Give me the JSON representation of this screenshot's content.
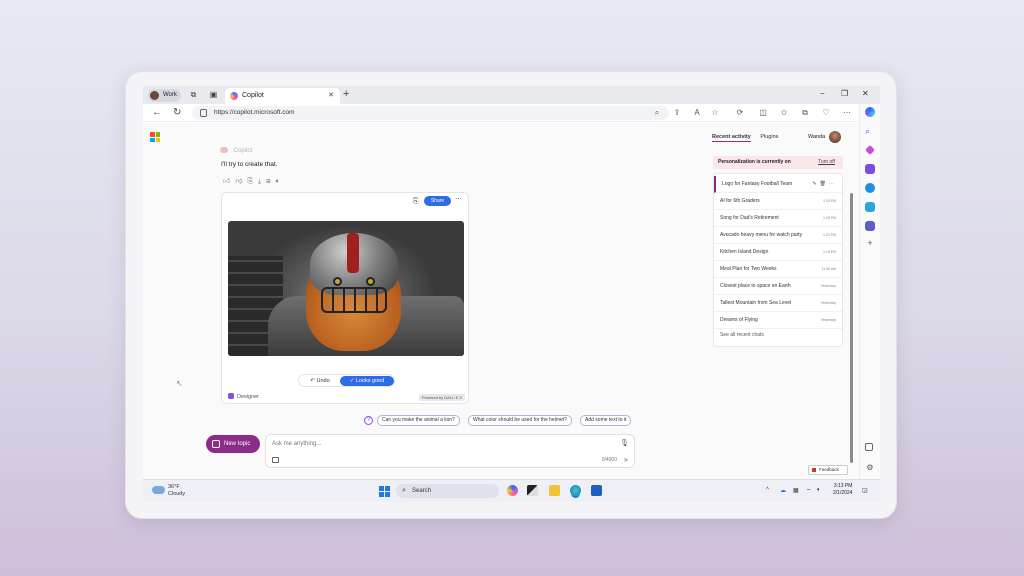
{
  "browser": {
    "profile_label": "Work",
    "tab_title": "Copilot",
    "url": "https://copilot.microsoft.com"
  },
  "chat": {
    "assistant_name": "Copilot",
    "reply": "I'll try to create that.",
    "share_label": "Share",
    "undo_label": "Undo",
    "looks_good_label": "Looks good",
    "designer_label": "Designer",
    "powered_label": "Powered by DALL·E 3"
  },
  "suggestions": [
    "Can you make the animal a lion?",
    "What color should be used for the helmet?",
    "Add some text to it"
  ],
  "composer": {
    "new_topic_label": "New topic",
    "placeholder": "Ask me anything...",
    "counter": "0/4000"
  },
  "side_panel": {
    "tab_recent": "Recent activity",
    "tab_plugins": "Plugins",
    "user_name": "Wanda",
    "personalization_text": "Personalization is currently on",
    "turn_off_label": "Turn off",
    "history": [
      {
        "title": "Logo for Fantasy Football Team",
        "time": ""
      },
      {
        "title": "AI for 6th Graders",
        "time": "1:33 PM"
      },
      {
        "title": "Song for Dad's Retirement",
        "time": "1:28 PM"
      },
      {
        "title": "Avocado heavy menu for watch party",
        "time": "1:22 PM"
      },
      {
        "title": "Kitchen Island Design",
        "time": "1:15 PM"
      },
      {
        "title": "Meal Plan for Two Weeks",
        "time": "11:35 AM"
      },
      {
        "title": "Closest place to space on Earth",
        "time": "Yesterday"
      },
      {
        "title": "Tallest Mountain from Sea Level",
        "time": "Yesterday"
      },
      {
        "title": "Dreams of Flying",
        "time": "Yesterday"
      }
    ],
    "see_all_label": "See all recent chats",
    "feedback_label": "Feedback"
  },
  "taskbar": {
    "temperature": "36°F",
    "weather": "Cloudy",
    "search_label": "Search",
    "time": "3:13 PM",
    "date": "2/1/2024"
  },
  "colors": {
    "accent_purple": "#8b2d88",
    "accent_blue": "#2f6be8"
  }
}
